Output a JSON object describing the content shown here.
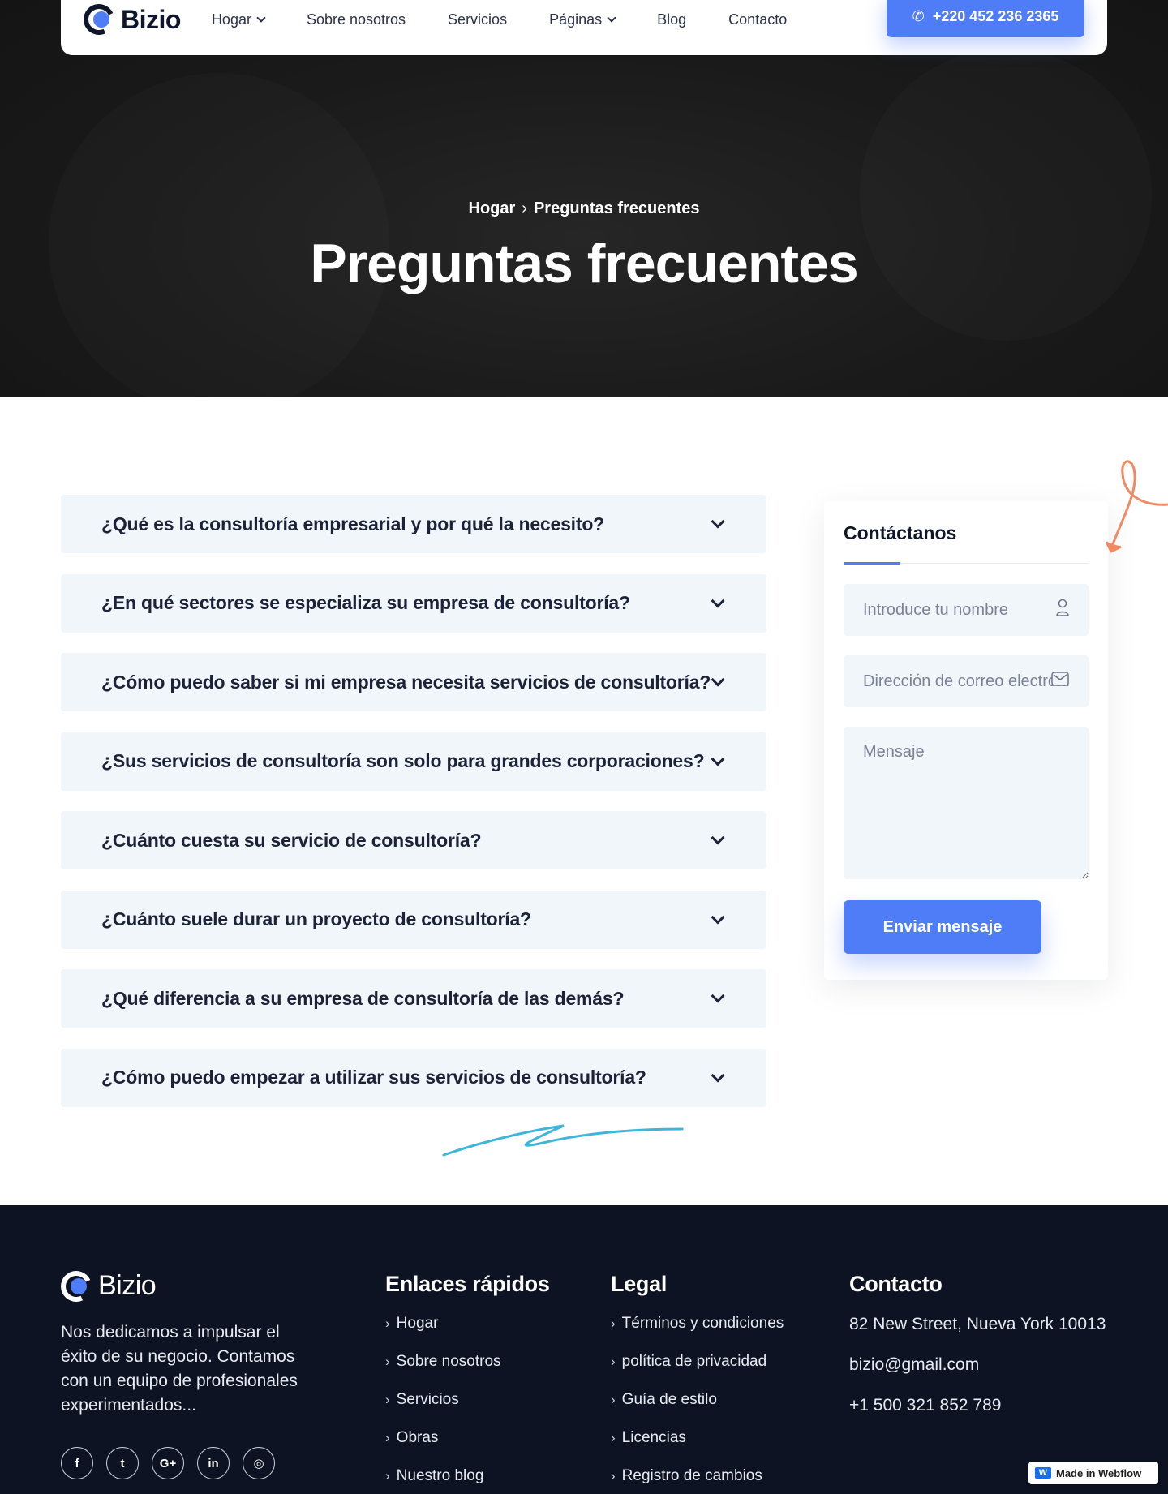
{
  "nav": {
    "logo_text": "Bizio",
    "items": [
      {
        "label": "Hogar",
        "has_dropdown": true
      },
      {
        "label": "Sobre nosotros",
        "has_dropdown": false
      },
      {
        "label": "Servicios",
        "has_dropdown": false
      },
      {
        "label": "Páginas",
        "has_dropdown": true
      },
      {
        "label": "Blog",
        "has_dropdown": false
      },
      {
        "label": "Contacto",
        "has_dropdown": false
      }
    ],
    "phone": "+220 452 236 2365"
  },
  "hero": {
    "breadcrumb_home": "Hogar",
    "breadcrumb_current": "Preguntas frecuentes",
    "title": "Preguntas frecuentes"
  },
  "faq": [
    "¿Qué es la consultoría empresarial y por qué la necesito?",
    "¿En qué sectores se especializa su empresa de consultoría?",
    "¿Cómo puedo saber si mi empresa necesita servicios de consultoría?",
    "¿Sus servicios de consultoría son solo para grandes corporaciones?",
    "¿Cuánto cuesta su servicio de consultoría?",
    "¿Cuánto suele durar un proyecto de consultoría?",
    "¿Qué diferencia a su empresa de consultoría de las demás?",
    "¿Cómo puedo empezar a utilizar sus servicios de consultoría?"
  ],
  "contact_form": {
    "title": "Contáctanos",
    "name_placeholder": "Introduce tu nombre",
    "email_placeholder": "Dirección de correo electrónico",
    "message_placeholder": "Mensaje",
    "submit_label": "Enviar mensaje"
  },
  "footer": {
    "logo_text": "Bizio",
    "about": "Nos dedicamos a impulsar el éxito de su negocio. Contamos con un equipo de profesionales experimentados...",
    "socials": [
      {
        "icon": "facebook-icon",
        "glyph": "f"
      },
      {
        "icon": "twitter-icon",
        "glyph": "t"
      },
      {
        "icon": "google-plus-icon",
        "glyph": "G+"
      },
      {
        "icon": "linkedin-icon",
        "glyph": "in"
      },
      {
        "icon": "instagram-icon",
        "glyph": "◎"
      }
    ],
    "quick_links": {
      "title": "Enlaces rápidos",
      "items": [
        "Hogar",
        "Sobre nosotros",
        "Servicios",
        "Obras",
        "Nuestro blog"
      ]
    },
    "legal": {
      "title": "Legal",
      "items": [
        "Términos y condiciones",
        "política de privacidad",
        "Guía de estilo",
        "Licencias",
        "Registro de cambios"
      ]
    },
    "contact": {
      "title": "Contacto",
      "address": "82 New Street, Nueva York 10013",
      "email": "bizio@gmail.com",
      "phone": "+1 500 321 852 789"
    }
  },
  "badge": {
    "label": "Made in Webflow"
  },
  "colors": {
    "accent": "#4f7cf7",
    "footer_bg": "#0d1322",
    "faq_bg": "#f1f6fa"
  }
}
